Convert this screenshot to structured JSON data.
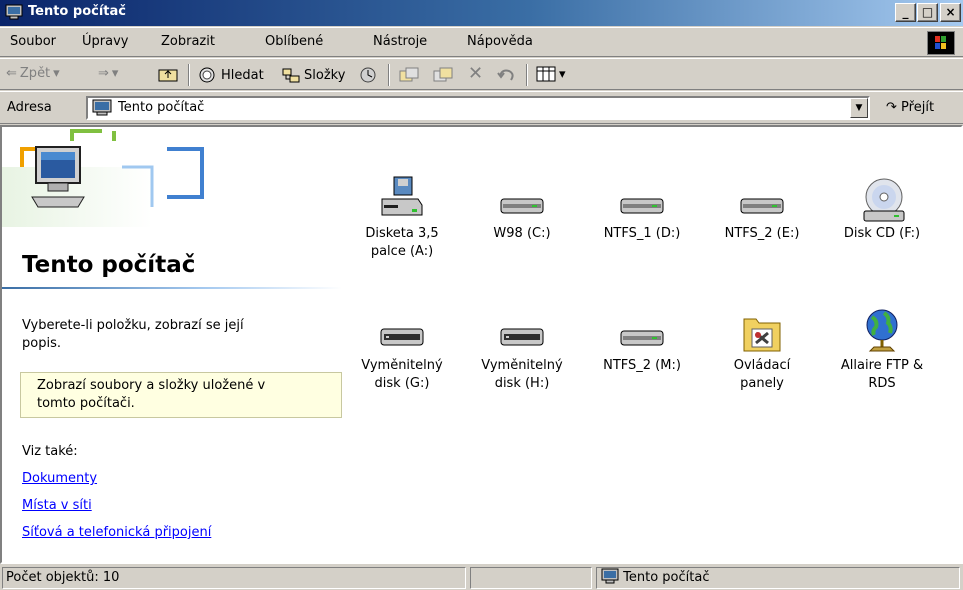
{
  "window": {
    "title": "Tento počítač",
    "buttons": [
      "_",
      "□",
      "×"
    ]
  },
  "menu": [
    "Soubor",
    "Úpravy",
    "Zobrazit",
    "Oblíbené",
    "Nástroje",
    "Nápověda"
  ],
  "toolbar": {
    "back": "Zpět",
    "search": "Hledat",
    "folders": "Složky"
  },
  "address": {
    "label": "Adresa",
    "value": "Tento počítač",
    "go": "Přejít"
  },
  "left_pane": {
    "title": "Tento počítač",
    "hint": [
      "Vyberete-li položku, zobrazí se její",
      "popis."
    ],
    "info": [
      "Zobrazí soubory a složky uložené v",
      "tomto počítači."
    ],
    "see_also": "Viz také:",
    "links": [
      "Dokumenty",
      "Místa v síti",
      "Síťová a telefonická připojení"
    ]
  },
  "items": [
    {
      "line1": "Disketa 3,5",
      "line2": "palce (A:)",
      "icon": "floppy-drive-icon"
    },
    {
      "line1": "W98 (C:)",
      "line2": "",
      "icon": "hard-disk-icon"
    },
    {
      "line1": "NTFS_1 (D:)",
      "line2": "",
      "icon": "hard-disk-icon"
    },
    {
      "line1": "NTFS_2 (E:)",
      "line2": "",
      "icon": "hard-disk-icon"
    },
    {
      "line1": "Disk CD (F:)",
      "line2": "",
      "icon": "cd-drive-icon"
    },
    {
      "line1": "Vyměnitelný",
      "line2": "disk (G:)",
      "icon": "removable-disk-icon"
    },
    {
      "line1": "Vyměnitelný",
      "line2": "disk (H:)",
      "icon": "removable-disk-icon"
    },
    {
      "line1": "NTFS_2 (M:)",
      "line2": "",
      "icon": "hard-disk-icon"
    },
    {
      "line1": "Ovládací",
      "line2": "panely",
      "icon": "control-panel-icon"
    },
    {
      "line1": "Allaire FTP &",
      "line2": "RDS",
      "icon": "globe-icon"
    }
  ],
  "status": {
    "count": "Počet objektů: 10",
    "location": "Tento počítač"
  }
}
